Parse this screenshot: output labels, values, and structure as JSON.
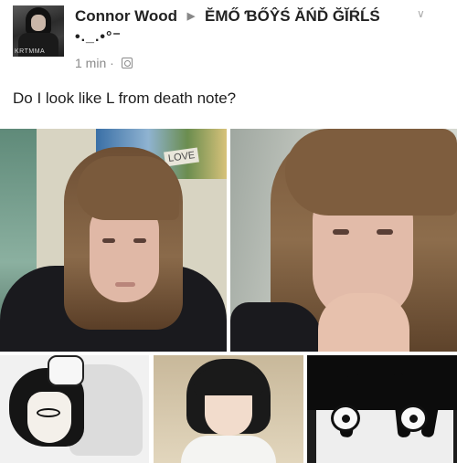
{
  "post": {
    "author": "Connor Wood",
    "group": "ĔMŐ ƁŐŶŚ ĂŃĎ ĞĬŔĹŚ",
    "emoticon": "•._.•°⁻",
    "time": "1 min",
    "separator": "·",
    "caption": "Do I look like L from death note?"
  },
  "avatar": {
    "tag": "KRTMMA"
  },
  "photos": {
    "photo1_sign": "LOVE"
  },
  "icons": {
    "share_arrow": "triangle-right-icon",
    "privacy": "globe-icon",
    "menu": "chevron-down-icon"
  },
  "colors": {
    "name_text": "#222222",
    "meta_text": "#8a8a8a",
    "background": "#ffffff"
  }
}
